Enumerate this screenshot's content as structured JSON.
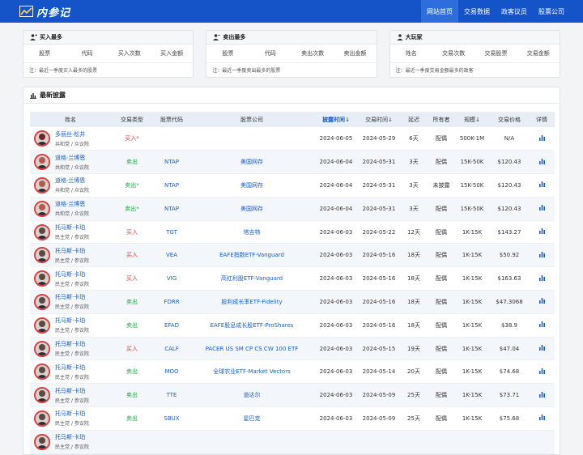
{
  "app": {
    "logo_text": "内参记"
  },
  "nav": [
    {
      "label": "网站首页",
      "active": true
    },
    {
      "label": "交易数据",
      "active": false
    },
    {
      "label": "政客议员",
      "active": false
    },
    {
      "label": "股票公司",
      "active": false
    }
  ],
  "cards": [
    {
      "title": "买入最多",
      "cols": [
        "股票",
        "代码",
        "买入次数",
        "买入金额"
      ],
      "note": "注：最近一季度买入最多的股票"
    },
    {
      "title": "卖出最多",
      "cols": [
        "股票",
        "代码",
        "卖出次数",
        "卖出金额"
      ],
      "note": "注：最近一季度卖出最多的股票"
    },
    {
      "title": "大玩家",
      "cols": [
        "姓名",
        "交易次数",
        "交易股票",
        "交易金额"
      ],
      "note": "注：最近一季度交易金额最多的政客"
    }
  ],
  "main": {
    "title": "最新披露",
    "headers": [
      "姓名",
      "交易类型",
      "股票代码",
      "股票公司",
      "披露时间",
      "交易时间",
      "延迟",
      "所有者",
      "规模",
      "交易价格",
      "详情"
    ],
    "rows": [
      {
        "name": "多丽丝·松井",
        "party": "共和党 / 众议院",
        "type": "买入*",
        "side": "buy",
        "code": "",
        "company": "",
        "disclosed": "2024-06-05",
        "traded": "2024-05-29",
        "delay": "6天",
        "owner": "配偶",
        "size": "500K-1M",
        "price": "N/A"
      },
      {
        "name": "道格·兰博恩",
        "party": "共和党 / 众议院",
        "type": "卖出",
        "side": "sell",
        "code": "NTAP",
        "company": "美国网存",
        "disclosed": "2024-06-04",
        "traded": "2024-05-31",
        "delay": "3天",
        "owner": "配偶",
        "size": "15K-50K",
        "price": "$120.43"
      },
      {
        "name": "道格·兰博恩",
        "party": "共和党 / 众议院",
        "type": "卖出*",
        "side": "sell",
        "code": "NTAP",
        "company": "美国网存",
        "disclosed": "2024-06-04",
        "traded": "2024-05-31",
        "delay": "3天",
        "owner": "未披露",
        "size": "15K-50K",
        "price": "$120.43"
      },
      {
        "name": "道格·兰博恩",
        "party": "共和党 / 众议院",
        "type": "卖出*",
        "side": "sell",
        "code": "NTAP",
        "company": "美国网存",
        "disclosed": "2024-06-04",
        "traded": "2024-05-31",
        "delay": "3天",
        "owner": "配偶",
        "size": "15K-50K",
        "price": "$120.43"
      },
      {
        "name": "托马斯·卡珀",
        "party": "民主党 / 参议院",
        "type": "买入",
        "side": "buy",
        "code": "TGT",
        "company": "塔吉特",
        "disclosed": "2024-06-03",
        "traded": "2024-05-22",
        "delay": "12天",
        "owner": "配偶",
        "size": "1K-15K",
        "price": "$143.27"
      },
      {
        "name": "托马斯·卡珀",
        "party": "民主党 / 参议院",
        "type": "买入",
        "side": "buy",
        "code": "VEA",
        "company": "EAFE指数ETF-Vanguard",
        "disclosed": "2024-06-03",
        "traded": "2024-05-16",
        "delay": "18天",
        "owner": "配偶",
        "size": "1K-15K",
        "price": "$50.92"
      },
      {
        "name": "托马斯·卡珀",
        "party": "民主党 / 参议院",
        "type": "买入",
        "side": "buy",
        "code": "VIG",
        "company": "高红利股ETF-Vanguard",
        "disclosed": "2024-06-03",
        "traded": "2024-05-16",
        "delay": "18天",
        "owner": "配偶",
        "size": "1K-15K",
        "price": "$163.63"
      },
      {
        "name": "托马斯·卡珀",
        "party": "民主党 / 参议院",
        "type": "卖出",
        "side": "sell",
        "code": "FDRR",
        "company": "股利成长率ETF-Fidelity",
        "disclosed": "2024-06-03",
        "traded": "2024-05-16",
        "delay": "18天",
        "owner": "配偶",
        "size": "1K-15K",
        "price": "$47.3068"
      },
      {
        "name": "托马斯·卡珀",
        "party": "民主党 / 参议院",
        "type": "卖出",
        "side": "sell",
        "code": "EFAD",
        "company": "EAFE股息成长股ETF-ProShares",
        "disclosed": "2024-06-03",
        "traded": "2024-05-16",
        "delay": "18天",
        "owner": "配偶",
        "size": "1K-15K",
        "price": "$38.9"
      },
      {
        "name": "托马斯·卡珀",
        "party": "民主党 / 参议院",
        "type": "买入",
        "side": "buy",
        "code": "CALF",
        "company": "PACER US SM CP CS CW 100 ETF",
        "disclosed": "2024-06-03",
        "traded": "2024-05-15",
        "delay": "19天",
        "owner": "配偶",
        "size": "1K-15K",
        "price": "$47.04"
      },
      {
        "name": "托马斯·卡珀",
        "party": "民主党 / 参议院",
        "type": "卖出",
        "side": "sell",
        "code": "MOO",
        "company": "全球农业ETF-Market Vectors",
        "disclosed": "2024-06-03",
        "traded": "2024-05-14",
        "delay": "20天",
        "owner": "配偶",
        "size": "1K-15K",
        "price": "$74.68"
      },
      {
        "name": "托马斯·卡珀",
        "party": "民主党 / 参议院",
        "type": "卖出",
        "side": "sell",
        "code": "TTE",
        "company": "道达尔",
        "disclosed": "2024-06-03",
        "traded": "2024-05-09",
        "delay": "25天",
        "owner": "配偶",
        "size": "1K-15K",
        "price": "$73.71"
      },
      {
        "name": "托马斯·卡珀",
        "party": "民主党 / 参议院",
        "type": "卖出",
        "side": "sell",
        "code": "SBUX",
        "company": "星巴克",
        "disclosed": "2024-06-03",
        "traded": "2024-05-09",
        "delay": "25天",
        "owner": "配偶",
        "size": "1K-15K",
        "price": "$75.68"
      },
      {
        "name": "托马斯·卡珀",
        "party": "民主党 / 参议院",
        "type": "",
        "side": "sell",
        "code": "",
        "company": "",
        "disclosed": "",
        "traded": "",
        "delay": "",
        "owner": "",
        "size": "",
        "price": ""
      }
    ]
  },
  "colors": {
    "brand": "#1554c8",
    "buy": "#e0403a",
    "sell": "#2aa84a",
    "link": "#1a5fc7"
  },
  "icons": {
    "logo": "chart-line-logo-icon",
    "buy": "user-plus-icon",
    "sell": "user-minus-icon",
    "player": "user-icon",
    "latest": "bar-chart-icon",
    "detail": "bar-chart-icon"
  }
}
